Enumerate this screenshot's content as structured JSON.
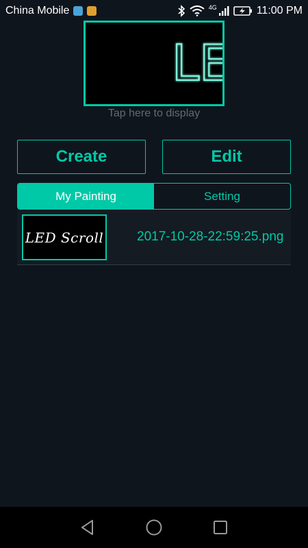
{
  "status_bar": {
    "carrier": "China Mobile",
    "network": "4G",
    "time": "11:00 PM",
    "icons": [
      "bluetooth-icon",
      "wifi-icon",
      "signal-icon",
      "battery-charging-icon"
    ]
  },
  "preview": {
    "led_text": "LE",
    "hint": "Tap here to display"
  },
  "actions": {
    "create_label": "Create",
    "edit_label": "Edit"
  },
  "tabs": [
    {
      "label": "My Painting",
      "active": true
    },
    {
      "label": "Setting",
      "active": false
    }
  ],
  "paintings": [
    {
      "thumbnail_text": "LED Scroll",
      "file_name": "2017-10-28-22:59:25.png"
    }
  ],
  "navigation": [
    "back-icon",
    "home-icon",
    "recents-icon"
  ],
  "colors": {
    "accent": "#00c9a7",
    "background": "#0f151d",
    "hint_text": "#5f6b73"
  }
}
